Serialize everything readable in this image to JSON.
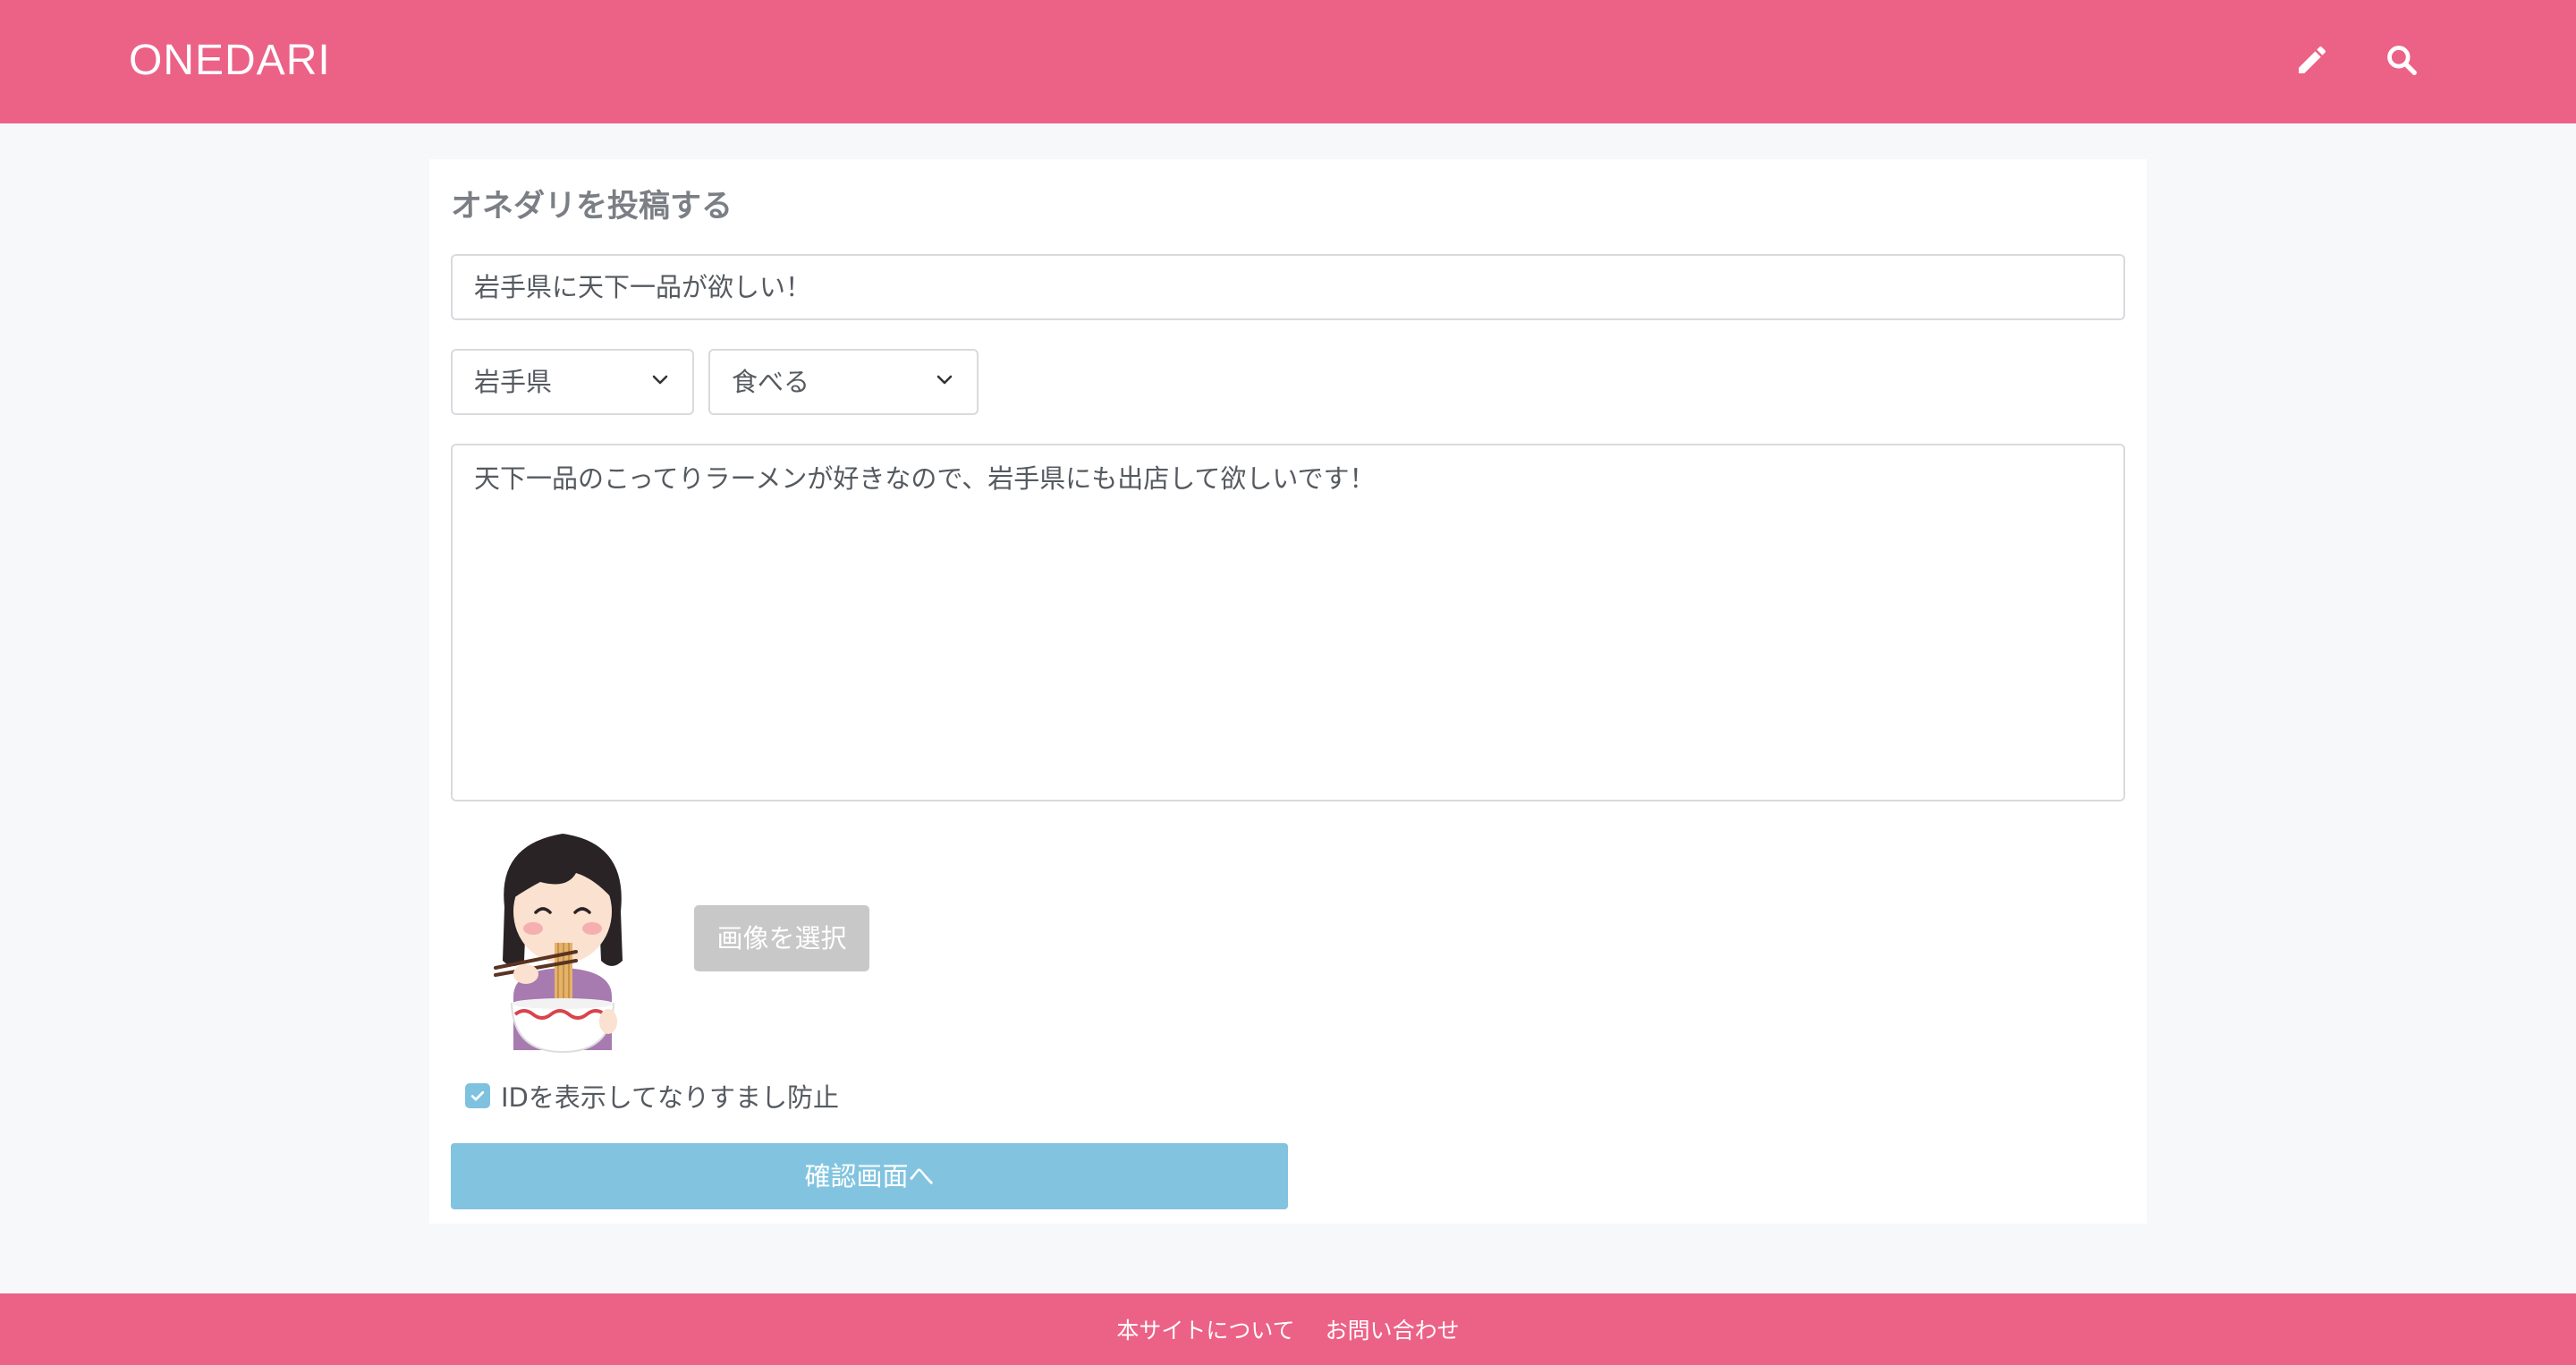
{
  "header": {
    "logo": "ONEDARI",
    "icons": [
      "pencil-icon",
      "search-icon"
    ],
    "background": "#ec6186"
  },
  "form": {
    "title": "オネダリを投稿する",
    "title_input_value": "岩手県に天下一品が欲しい！",
    "prefecture_select": "岩手県",
    "category_select": "食べる",
    "body_text": "天下一品のこってりラーメンが好きなので、岩手県にも出店して欲しいです！",
    "image_button": "画像を選択",
    "id_checkbox_label": "IDを表示してなりすまし防止",
    "id_checkbox_checked": true,
    "confirm_button": "確認画面へ"
  },
  "footer": {
    "links": [
      "本サイトについて",
      "お問い合わせ"
    ]
  },
  "colors": {
    "brand": "#ec6186",
    "accent": "#82c4e0",
    "disabled": "#c8c8c8"
  }
}
